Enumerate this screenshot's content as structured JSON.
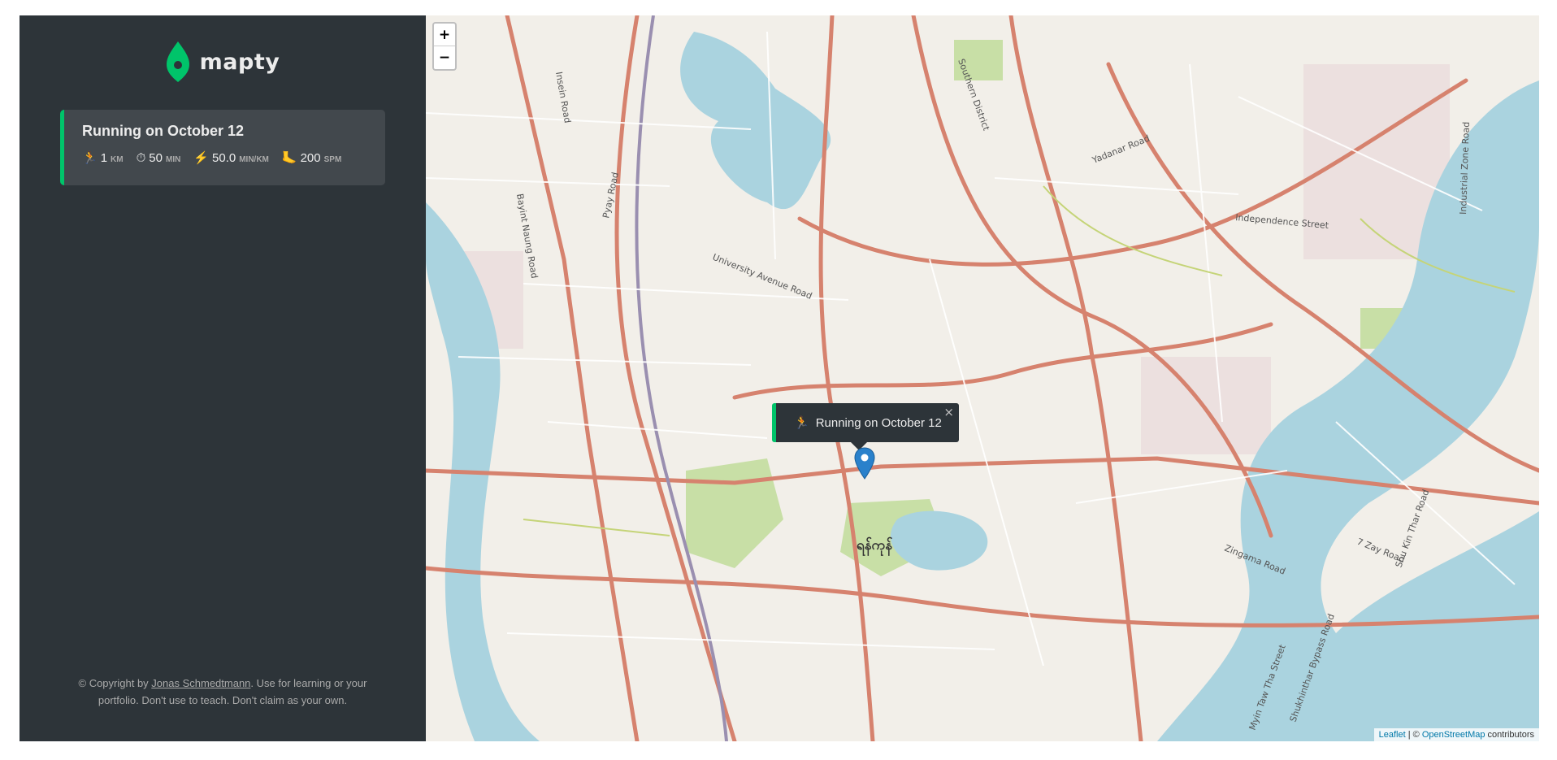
{
  "brand": {
    "name": "mapty",
    "accent": "#00c46a"
  },
  "workouts": [
    {
      "title": "Running on October 12",
      "details": [
        {
          "icon": "🏃",
          "icon_name": "running-icon",
          "value": "1",
          "unit": "km"
        },
        {
          "icon": "⏱",
          "icon_name": "stopwatch-icon",
          "value": "50",
          "unit": "min"
        },
        {
          "icon": "⚡",
          "icon_name": "lightning-icon",
          "value": "50.0",
          "unit": "min/km"
        },
        {
          "icon": "🦶",
          "icon_name": "footprint-icon",
          "value": "200",
          "unit": "spm"
        }
      ]
    }
  ],
  "copyright": {
    "prefix": "© Copyright by ",
    "author": "Jonas Schmedtmann",
    "suffix": ". Use for learning or your portfolio. Don't use to teach. Don't claim as your own."
  },
  "map": {
    "zoom_in": "+",
    "zoom_out": "−",
    "popup": {
      "icon": "🏃",
      "text": "Running on October 12",
      "close": "×"
    },
    "city_label": "ရန်ကုန်",
    "street_labels": [
      "University Avenue Road",
      "Independence Street",
      "Yadanar Road",
      "Zingama Road",
      "7 Zay Road",
      "Industrial Zone Road",
      "Shu Kin Thar Road",
      "Myin Taw Tha Street",
      "Shukhinthar Bypass Road",
      "Bayint Naung Road",
      "Insein Road",
      "Pyay Road",
      "Southern District"
    ],
    "attribution": {
      "leaflet": "Leaflet",
      "sep": " | © ",
      "osm": "OpenStreetMap",
      "suffix": " contributors"
    },
    "colors": {
      "water": "#aad3df",
      "road_major": "#d6826e",
      "road_minor": "#ffffff",
      "park": "#c8dfa6",
      "land": "#f2efe9",
      "industrial": "#e5d1d6"
    }
  }
}
